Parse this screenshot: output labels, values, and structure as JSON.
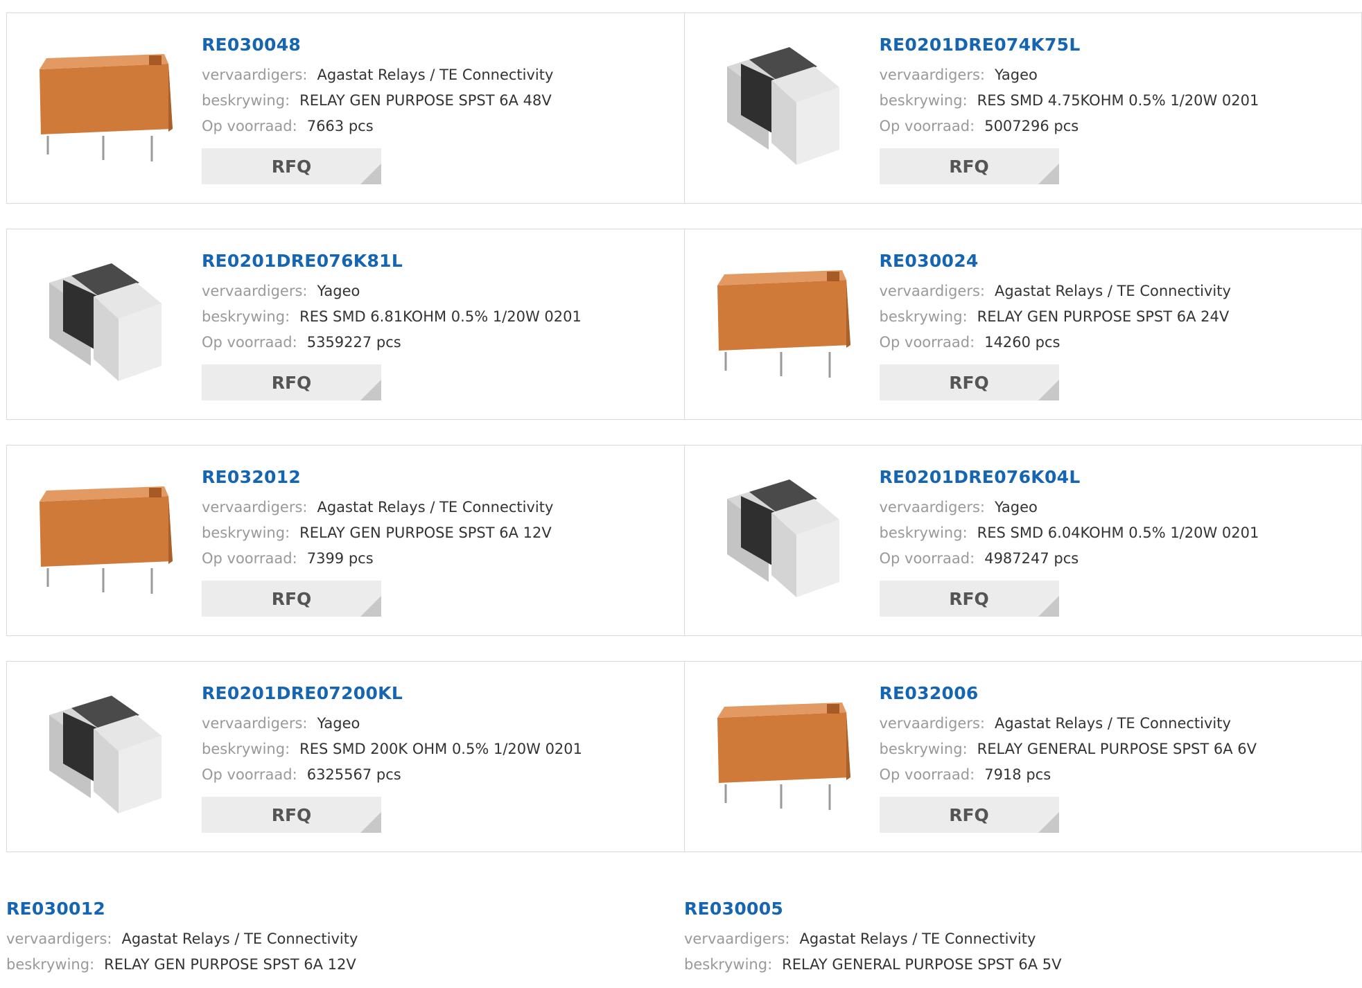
{
  "labels": {
    "manufacturer": "vervaardigers:",
    "description": "beskrywing:",
    "stock": "Op voorraad:",
    "rfq": "RFQ"
  },
  "colors": {
    "link": "#1565b3",
    "label": "#999999",
    "value": "#333333",
    "button_bg": "#ececec"
  },
  "rows": [
    {
      "cards": [
        {
          "part": "RE030048",
          "image": "relay-icon",
          "manufacturer": "Agastat Relays / TE Connectivity",
          "description": "RELAY GEN PURPOSE SPST 6A 48V",
          "stock": "7663 pcs"
        },
        {
          "part": "RE0201DRE074K75L",
          "image": "chip-resistor-icon",
          "manufacturer": "Yageo",
          "description": "RES SMD 4.75KOHM 0.5% 1/20W 0201",
          "stock": "5007296 pcs"
        }
      ]
    },
    {
      "cards": [
        {
          "part": "RE0201DRE076K81L",
          "image": "chip-resistor-icon",
          "manufacturer": "Yageo",
          "description": "RES SMD 6.81KOHM 0.5% 1/20W 0201",
          "stock": "5359227 pcs"
        },
        {
          "part": "RE030024",
          "image": "relay-icon",
          "manufacturer": "Agastat Relays / TE Connectivity",
          "description": "RELAY GEN PURPOSE SPST 6A 24V",
          "stock": "14260 pcs"
        }
      ]
    },
    {
      "cards": [
        {
          "part": "RE032012",
          "image": "relay-icon",
          "manufacturer": "Agastat Relays / TE Connectivity",
          "description": "RELAY GEN PURPOSE SPST 6A 12V",
          "stock": "7399 pcs"
        },
        {
          "part": "RE0201DRE076K04L",
          "image": "chip-resistor-icon",
          "manufacturer": "Yageo",
          "description": "RES SMD 6.04KOHM 0.5% 1/20W 0201",
          "stock": "4987247 pcs"
        }
      ]
    },
    {
      "cards": [
        {
          "part": "RE0201DRE07200KL",
          "image": "chip-resistor-icon",
          "manufacturer": "Yageo",
          "description": "RES SMD 200K OHM 0.5% 1/20W 0201",
          "stock": "6325567 pcs"
        },
        {
          "part": "RE032006",
          "image": "relay-icon",
          "manufacturer": "Agastat Relays / TE Connectivity",
          "description": "RELAY GENERAL PURPOSE SPST 6A 6V",
          "stock": "7918 pcs"
        }
      ]
    },
    {
      "cards": [
        {
          "part": "RE030012",
          "manufacturer": "Agastat Relays / TE Connectivity",
          "description": "RELAY GEN PURPOSE SPST 6A 12V"
        },
        {
          "part": "RE030005",
          "manufacturer": "Agastat Relays / TE Connectivity",
          "description": "RELAY GENERAL PURPOSE SPST 6A 5V"
        }
      ]
    }
  ]
}
